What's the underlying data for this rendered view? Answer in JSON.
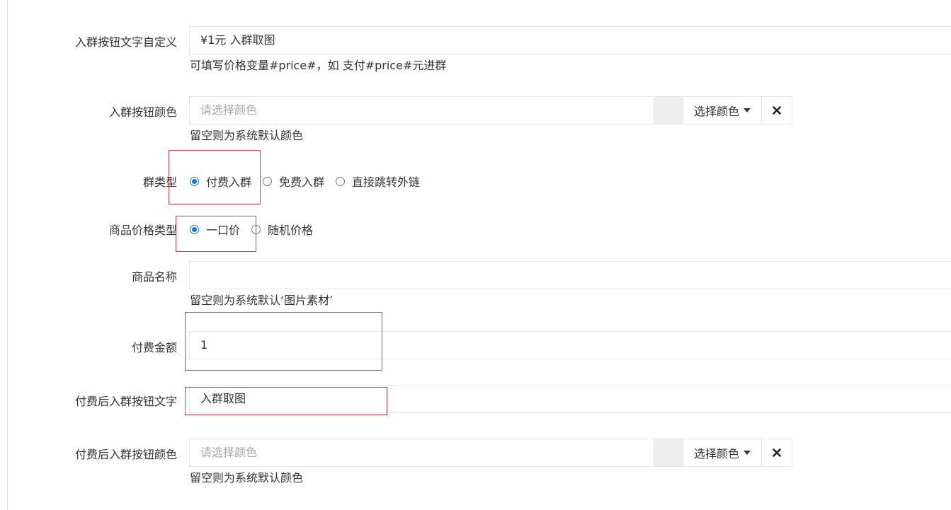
{
  "form": {
    "join_button_text": {
      "label": "入群按钮文字自定义",
      "value": "¥1元 入群取图",
      "help": "可填写价格变量#price#，如 支付#price#元进群"
    },
    "join_button_color": {
      "label": "入群按钮颜色",
      "placeholder": "请选择颜色",
      "pick_label": "选择颜色",
      "help": "留空则为系统默认颜色"
    },
    "group_type": {
      "label": "群类型",
      "options": [
        "付费入群",
        "免费入群",
        "直接跳转外链"
      ],
      "selected": "付费入群"
    },
    "price_type": {
      "label": "商品价格类型",
      "options": [
        "一口价",
        "随机价格"
      ],
      "selected": "一口价"
    },
    "product_name": {
      "label": "商品名称",
      "value": "",
      "help": "留空则为系统默认‘图片素材’"
    },
    "amount": {
      "label": "付费金额",
      "value": "1"
    },
    "paid_button_text": {
      "label": "付费后入群按钮文字",
      "value": "入群取图"
    },
    "paid_button_color": {
      "label": "付费后入群按钮颜色",
      "placeholder": "请选择颜色",
      "pick_label": "选择颜色",
      "help": "留空则为系统默认颜色"
    }
  },
  "icons": {
    "caret": "caret-down-icon",
    "clear": "close-icon"
  },
  "colors": {
    "radio_checked": "#1a73e8",
    "highlight_box": "#d9363e",
    "border": "#e6e6e6",
    "swatch": "#eeeeee"
  }
}
